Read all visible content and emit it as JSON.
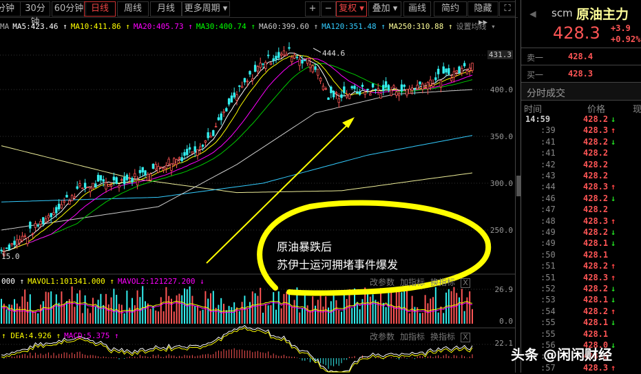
{
  "toolbar": {
    "periods": [
      "分钟",
      "30分钟",
      "60分钟",
      "日线",
      "周线",
      "月线",
      "更多周期 ▾"
    ],
    "active": "日线",
    "right": [
      "+",
      "−",
      "复权 ▾",
      "叠加 ▾",
      "画线",
      "简约",
      "隐藏 ▸▸",
      "⛶"
    ]
  },
  "ma_legend": [
    {
      "label": "MA",
      "color": "#aaa"
    },
    {
      "label": "MA5:423.46 ↑",
      "color": "#fff"
    },
    {
      "label": "MA10:411.86 ↑",
      "color": "#ff0"
    },
    {
      "label": "MA20:405.73 ↑",
      "color": "#f0f"
    },
    {
      "label": "MA30:400.74 ↑",
      "color": "#0f0"
    },
    {
      "label": "MA60:399.60 ↑",
      "color": "#ccc"
    },
    {
      "label": "MA120:351.48 ↑",
      "color": "#3cf"
    },
    {
      "label": "MA250:310.88 ↑",
      "color": "#ff9"
    },
    {
      "label": "设置均线 ▾",
      "color": "#888"
    }
  ],
  "price_axis": [
    "431.3",
    "400.0",
    "350.0",
    "300.0",
    "250.0"
  ],
  "labels": {
    "high": "444.6",
    "low": "15.0"
  },
  "volume": {
    "legend": [
      {
        "label": "000 ↑",
        "color": "#fff"
      },
      {
        "label": "MAVOL1:101341.000 ↑",
        "color": "#ff0"
      },
      {
        "label": "MAVOL2:121227.200 ↓",
        "color": "#f0f"
      }
    ],
    "axis": [
      "26.9",
      "0.0"
    ]
  },
  "macd": {
    "legend": [
      {
        "label": "↑ DEA:4.926 ↑",
        "color": "#ff0"
      },
      {
        "label": "MACD:5.375 ↑",
        "color": "#f0f"
      }
    ],
    "axis": [
      "22.1"
    ]
  },
  "panel_buttons": [
    "改参数",
    "加指标",
    "换指标",
    "X"
  ],
  "quote": {
    "code": "scm",
    "name": "原油主力",
    "price": "428.3",
    "change": "+3.9",
    "pct": "+0.92%",
    "ask_label": "卖一",
    "ask": "428.4",
    "bid_label": "买一",
    "bid": "428.3",
    "section": "分时成交",
    "col_time": "时间",
    "col_price": "价格",
    "col_vol": "现"
  },
  "ticks": [
    [
      "14:59",
      "428.2",
      "↓"
    ],
    [
      ":39",
      "428.3",
      "↑"
    ],
    [
      ":41",
      "428.2",
      "↓"
    ],
    [
      ":41",
      "428.2",
      ""
    ],
    [
      ":42",
      "428.2",
      ""
    ],
    [
      ":43",
      "428.2",
      ""
    ],
    [
      ":44",
      "428.3",
      "↑"
    ],
    [
      ":46",
      "428.2",
      "↓"
    ],
    [
      ":47",
      "428.2",
      ""
    ],
    [
      ":48",
      "428.3",
      "↑"
    ],
    [
      ":49",
      "428.2",
      "↓"
    ],
    [
      ":49",
      "428.1",
      "↓"
    ],
    [
      ":50",
      "428.1",
      ""
    ],
    [
      ":51",
      "428.2",
      "↑"
    ],
    [
      ":51",
      "428.3",
      "↑"
    ],
    [
      ":52",
      "428.2",
      "↓"
    ],
    [
      ":53",
      "428.1",
      "↓"
    ],
    [
      ":54",
      "428.2",
      "↑"
    ],
    [
      ":55",
      "428.1",
      "↓"
    ],
    [
      ":55",
      "428.1",
      ""
    ],
    [
      ":56",
      "428.0",
      "↓"
    ],
    [
      ":56",
      "428.0",
      ""
    ],
    [
      ":57",
      "428.3",
      "↑"
    ]
  ],
  "annotation": {
    "line1": "原油暴跌后",
    "line2": "苏伊士运河拥堵事件爆发"
  },
  "watermark": "头条 @闲闲财经",
  "chart_data": {
    "type": "candlestick",
    "key_closes": [
      [
        0,
        228
      ],
      [
        10,
        245
      ],
      [
        20,
        270
      ],
      [
        30,
        295
      ],
      [
        40,
        300
      ],
      [
        50,
        305
      ],
      [
        60,
        318
      ],
      [
        70,
        330
      ],
      [
        80,
        350
      ],
      [
        90,
        395
      ],
      [
        100,
        430
      ],
      [
        110,
        440
      ],
      [
        120,
        425
      ],
      [
        125,
        392
      ],
      [
        135,
        398
      ],
      [
        145,
        400
      ],
      [
        155,
        400
      ],
      [
        165,
        410
      ],
      [
        175,
        420
      ],
      [
        180,
        428.3
      ]
    ],
    "ma60": [
      [
        0,
        250
      ],
      [
        60,
        275
      ],
      [
        90,
        320
      ],
      [
        120,
        375
      ],
      [
        150,
        395
      ],
      [
        180,
        400
      ]
    ],
    "ma120": [
      [
        0,
        280
      ],
      [
        60,
        285
      ],
      [
        100,
        300
      ],
      [
        140,
        330
      ],
      [
        180,
        351
      ]
    ],
    "ma250": [
      [
        0,
        340
      ],
      [
        50,
        305
      ],
      [
        90,
        290
      ],
      [
        130,
        292
      ],
      [
        180,
        311
      ]
    ],
    "ylim": [
      215,
      445
    ]
  }
}
